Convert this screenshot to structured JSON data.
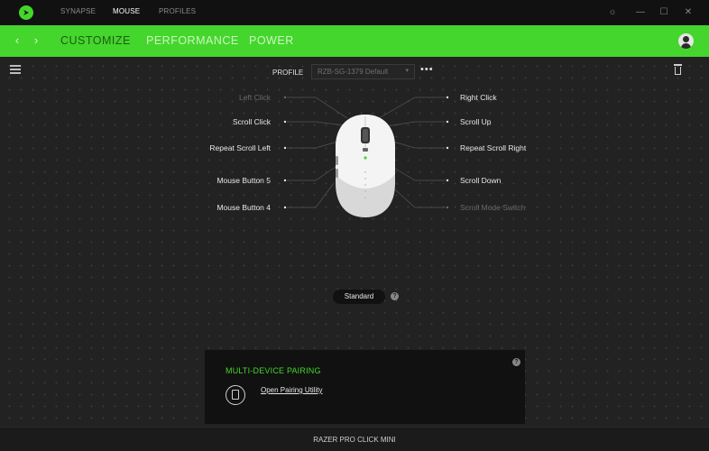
{
  "titlebar": {
    "tabs": [
      {
        "label": "SYNAPSE",
        "active": false
      },
      {
        "label": "MOUSE",
        "active": true
      },
      {
        "label": "PROFILES",
        "active": false
      }
    ],
    "icons": [
      "razer-logo-icon",
      "settings-icon",
      "minimize-icon",
      "maximize-icon",
      "close-icon"
    ]
  },
  "nav": {
    "tabs": [
      {
        "label": "CUSTOMIZE",
        "active": true
      },
      {
        "label": "PERFORMANCE",
        "active": false
      },
      {
        "label": "POWER",
        "active": false
      }
    ],
    "accent_color": "#44d62c"
  },
  "profile": {
    "label": "PROFILE",
    "selected": "RZB-SG-1379 Default",
    "more": "•••"
  },
  "buttons": {
    "left": [
      {
        "label": "Left Click",
        "dim": true
      },
      {
        "label": "Scroll Click",
        "dim": false
      },
      {
        "label": "Repeat Scroll Left",
        "dim": false
      },
      {
        "label": "Mouse Button 5",
        "dim": false
      },
      {
        "label": "Mouse Button 4",
        "dim": false
      }
    ],
    "right": [
      {
        "label": "Right Click",
        "dim": false
      },
      {
        "label": "Scroll Up",
        "dim": false
      },
      {
        "label": "Repeat Scroll Right",
        "dim": false
      },
      {
        "label": "Scroll Down",
        "dim": false
      },
      {
        "label": "Scroll Mode Switch",
        "dim": true
      }
    ]
  },
  "mode": {
    "label": "Standard",
    "help": "?"
  },
  "pairing": {
    "title": "MULTI-DEVICE PAIRING",
    "link": "Open Pairing Utility",
    "help": "?"
  },
  "device": {
    "name": "RAZER PRO CLICK MINI"
  }
}
